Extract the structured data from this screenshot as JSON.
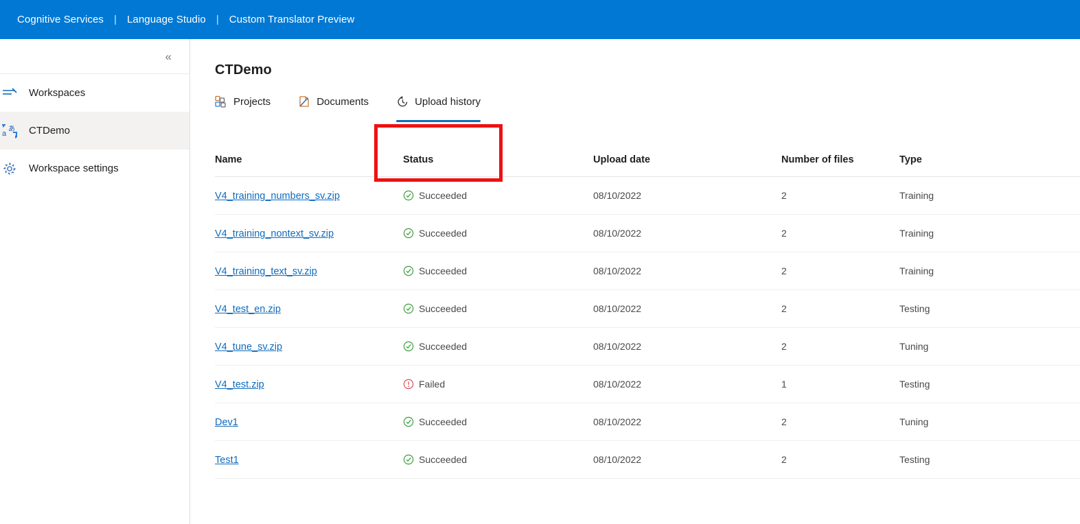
{
  "header": {
    "crumbs": [
      "Cognitive Services",
      "Language Studio",
      "Custom Translator Preview"
    ],
    "separator": "|",
    "background": "#0078d4"
  },
  "sidebar": {
    "collapse_icon": "chevron-double-left-icon",
    "items": [
      {
        "label": "Workspaces",
        "icon": "list-icon",
        "selected": false
      },
      {
        "label": "CTDemo",
        "icon": "translate-icon",
        "selected": true
      },
      {
        "label": "Workspace settings",
        "icon": "gear-icon",
        "selected": false
      }
    ]
  },
  "main": {
    "title": "CTDemo",
    "tabs": [
      {
        "label": "Projects",
        "icon": "projects-icon",
        "active": false
      },
      {
        "label": "Documents",
        "icon": "documents-icon",
        "active": false
      },
      {
        "label": "Upload history",
        "icon": "upload-history-icon",
        "active": true
      }
    ],
    "annotation": {
      "color": "#ee1111",
      "target": "Upload history"
    },
    "table": {
      "columns": [
        "Name",
        "Status",
        "Upload date",
        "Number of files",
        "Type"
      ],
      "rows": [
        {
          "name": "V4_training_numbers_sv.zip",
          "status": "Succeeded",
          "status_icon": "check-circle-icon",
          "date": "08/10/2022",
          "files": "2",
          "type": "Training"
        },
        {
          "name": "V4_training_nontext_sv.zip",
          "status": "Succeeded",
          "status_icon": "check-circle-icon",
          "date": "08/10/2022",
          "files": "2",
          "type": "Training"
        },
        {
          "name": "V4_training_text_sv.zip",
          "status": "Succeeded",
          "status_icon": "check-circle-icon",
          "date": "08/10/2022",
          "files": "2",
          "type": "Training"
        },
        {
          "name": "V4_test_en.zip",
          "status": "Succeeded",
          "status_icon": "check-circle-icon",
          "date": "08/10/2022",
          "files": "2",
          "type": "Testing"
        },
        {
          "name": "V4_tune_sv.zip",
          "status": "Succeeded",
          "status_icon": "check-circle-icon",
          "date": "08/10/2022",
          "files": "2",
          "type": "Tuning"
        },
        {
          "name": "V4_test.zip",
          "status": "Failed",
          "status_icon": "error-circle-icon",
          "date": "08/10/2022",
          "files": "1",
          "type": "Testing"
        },
        {
          "name": "Dev1",
          "status": "Succeeded",
          "status_icon": "check-circle-icon",
          "date": "08/10/2022",
          "files": "2",
          "type": "Tuning"
        },
        {
          "name": "Test1",
          "status": "Succeeded",
          "status_icon": "check-circle-icon",
          "date": "08/10/2022",
          "files": "2",
          "type": "Testing"
        }
      ]
    }
  },
  "colors": {
    "accent": "#0078d4",
    "link": "#0f6cbd",
    "success": "#107c10",
    "error": "#d13438",
    "selected_bg": "#f3f2f1"
  }
}
